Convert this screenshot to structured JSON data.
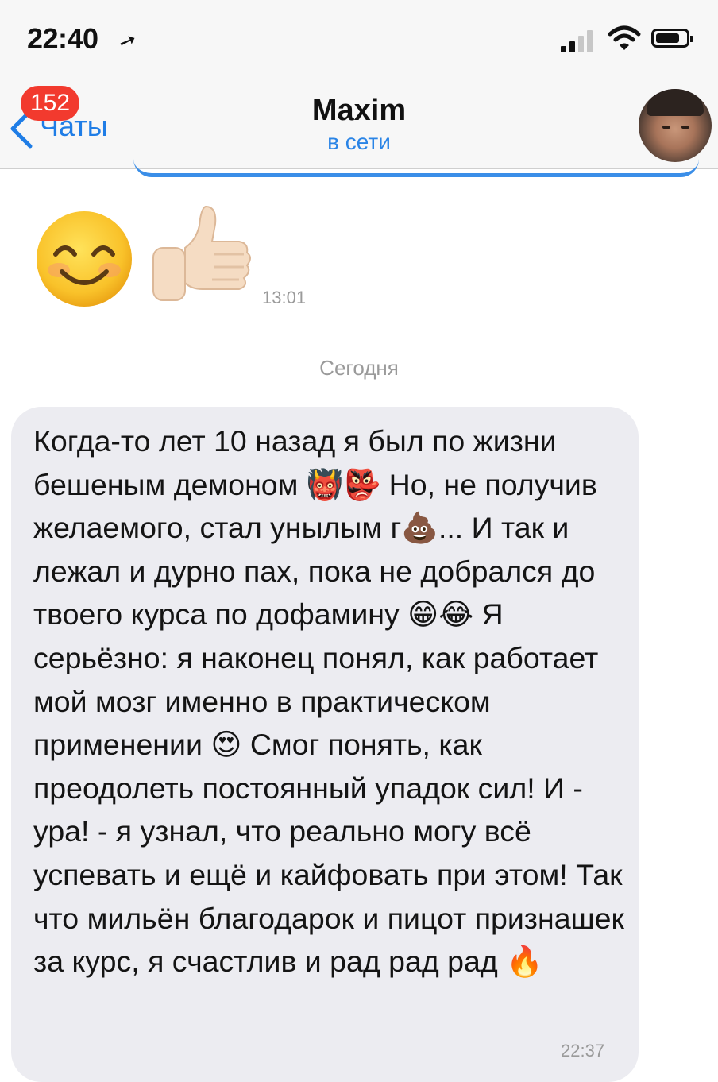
{
  "status_bar": {
    "time": "22:40",
    "location_arrow": "➚",
    "signal_icon": "cellular-signal-icon",
    "wifi_icon": "wifi-icon",
    "battery_icon": "battery-icon",
    "battery_level": 0.8
  },
  "nav": {
    "back_label": "Чаты",
    "badge_count": "152",
    "title": "Maxim",
    "subtitle": "в сети",
    "avatar_icon": "contact-avatar-photo"
  },
  "messages": {
    "emoji_message": {
      "emojis": [
        "😊",
        "👍🏻"
      ],
      "time": "13:01"
    },
    "date_separator": "Сегодня",
    "text_message": {
      "text": "Когда-то лет 10 назад я был по жизни бешеным демоном 👹👺 Но, не получив желаемого, стал унылым г💩... И так и лежал и дурно пах, пока не добрался до твоего курса по дофамину 😁😂 Я серьёзно: я наконец понял, как работает мой мозг именно в практическом применении 😍 Смог понять, как преодолеть постоянный упадок сил! И - ура! - я узнал, что реально могу всё успевать и ещё и кайфовать при этом! Так что мильён благодарок и пицот признашек за курс, я счастлив и рад рад рад 🔥",
      "time": "22:37"
    }
  },
  "colors": {
    "accent": "#1f7de6",
    "badge": "#f23a2e",
    "bubble_incoming": "#ececf1",
    "bar_background": "#f7f7f7",
    "muted_text": "#9a9a9a"
  }
}
